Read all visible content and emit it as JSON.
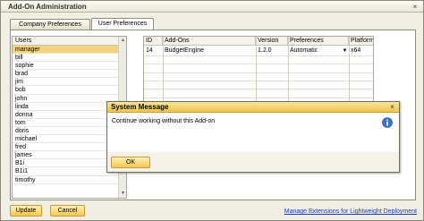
{
  "window": {
    "title": "Add-On Administration",
    "close_glyph": "×"
  },
  "tabs": [
    {
      "label": "Company Preferences",
      "active": false
    },
    {
      "label": "User Preferences",
      "active": true
    }
  ],
  "users": {
    "header": "Users",
    "items": [
      "manager",
      "bill",
      "sophie",
      "brad",
      "jim",
      "bob",
      "john",
      "linda",
      "donna",
      "tom",
      "doris",
      "michael",
      "fred",
      "james",
      "B1i",
      "B1i1",
      "timothy"
    ],
    "selected": "manager"
  },
  "addons_table": {
    "columns": [
      "ID",
      "Add-Ons",
      "Version",
      "Preferences",
      "Platform"
    ],
    "rows": [
      {
        "id": "14",
        "addon": "BudgetEngine",
        "version": "1.2.0",
        "preference": "Automatic",
        "platform": "x64"
      }
    ]
  },
  "dialog": {
    "title": "System Message",
    "message": "Continue working without this Add-on",
    "ok_label": "OK",
    "close_glyph": "×"
  },
  "footer": {
    "update_label": "Update",
    "cancel_label": "Cancel",
    "manage_link": "Manage Extensions for Lightweight Deployment"
  },
  "colors": {
    "accent": "#f4c84e",
    "selection": "#f4d37f",
    "link": "#1d3dbb",
    "dialog_title": "#ecc54c"
  }
}
